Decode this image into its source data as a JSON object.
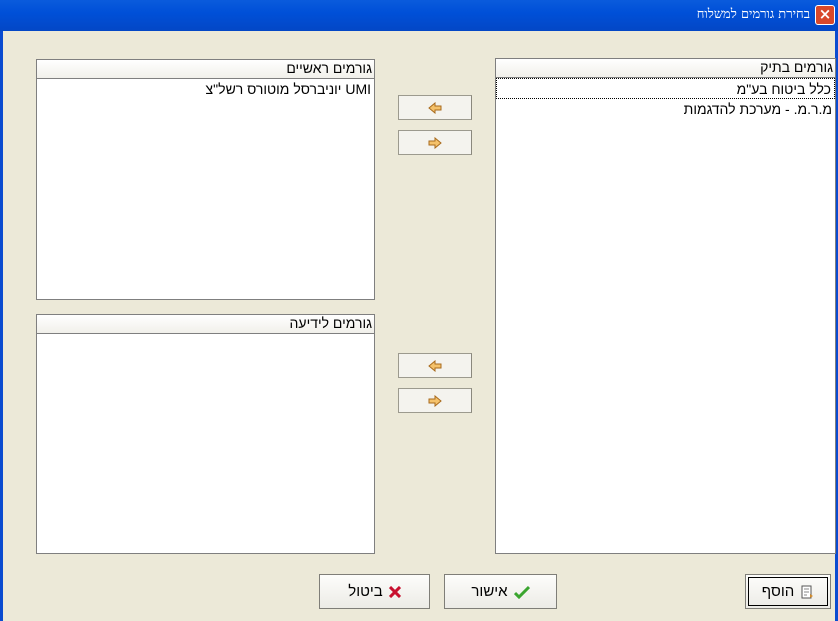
{
  "window": {
    "title": "בחירת גורמים למשלוח"
  },
  "panels": {
    "in_file": {
      "header": "גורמים בתיק",
      "items": [
        "כלל ביטוח בע\"מ",
        "מ.ר.מ. - מערכת להדגמות"
      ]
    },
    "primary": {
      "header": "גורמים ראשיים",
      "items": [
        "UMI יוניברסל מוטורס רשל\"צ"
      ]
    },
    "info": {
      "header": "גורמים לידיעה",
      "items": []
    }
  },
  "buttons": {
    "add": "הוסף",
    "confirm": "אישור",
    "cancel": "ביטול"
  },
  "icons": {
    "left_arrow": "left-arrow-icon",
    "right_arrow": "right-arrow-icon",
    "add": "add-doc-icon",
    "confirm": "checkmark-icon",
    "cancel": "x-icon"
  },
  "colors": {
    "title_bar": "#0050d8",
    "dialog_bg": "#ece9d8",
    "arrow_fill": "#f5c26b",
    "check": "#3aa52f",
    "x": "#c8102e"
  }
}
